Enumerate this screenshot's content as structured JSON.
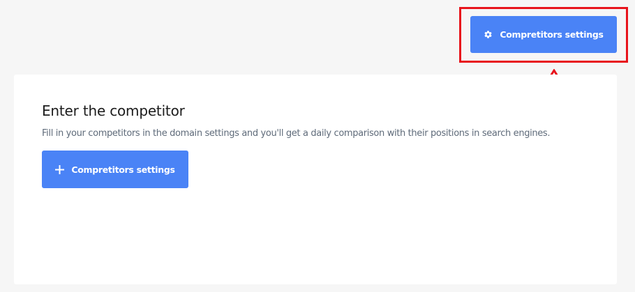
{
  "header": {
    "settings_button_label": "Compretitors settings",
    "settings_icon": "gear-icon"
  },
  "annotation": {
    "highlight_color": "#e8141c",
    "arrow_icon": "up-arrow-icon"
  },
  "card": {
    "title": "Enter the competitor",
    "description": "Fill in your competitors in the domain settings and you'll get a daily comparison with their positions in search engines.",
    "button_label": "Compretitors settings",
    "button_icon": "plus-icon"
  },
  "colors": {
    "accent": "#4a83f6",
    "background": "#f6f6f6",
    "card": "#ffffff"
  }
}
